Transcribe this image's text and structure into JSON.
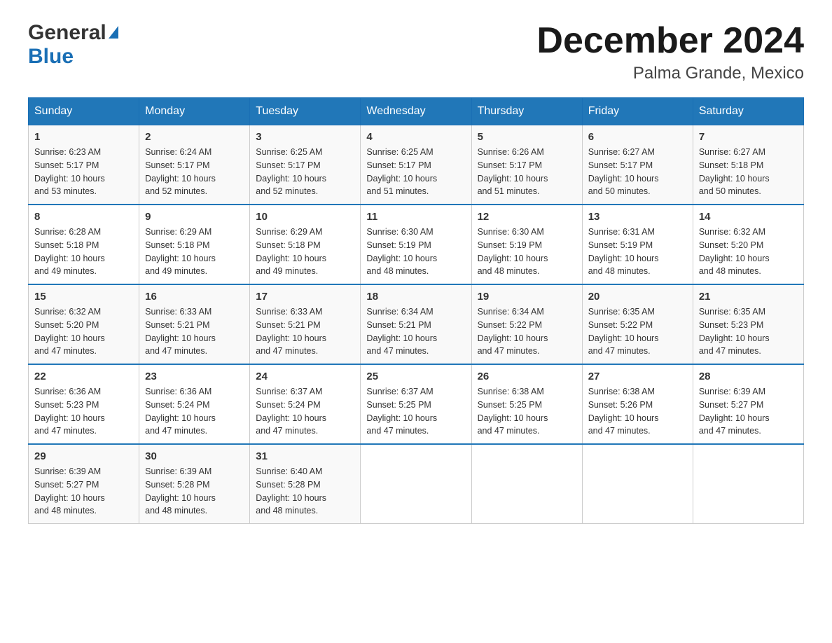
{
  "header": {
    "logo_general": "General",
    "logo_blue": "Blue",
    "month_title": "December 2024",
    "location": "Palma Grande, Mexico"
  },
  "days_of_week": [
    "Sunday",
    "Monday",
    "Tuesday",
    "Wednesday",
    "Thursday",
    "Friday",
    "Saturday"
  ],
  "weeks": [
    [
      {
        "day": "1",
        "sunrise": "6:23 AM",
        "sunset": "5:17 PM",
        "daylight": "10 hours and 53 minutes."
      },
      {
        "day": "2",
        "sunrise": "6:24 AM",
        "sunset": "5:17 PM",
        "daylight": "10 hours and 52 minutes."
      },
      {
        "day": "3",
        "sunrise": "6:25 AM",
        "sunset": "5:17 PM",
        "daylight": "10 hours and 52 minutes."
      },
      {
        "day": "4",
        "sunrise": "6:25 AM",
        "sunset": "5:17 PM",
        "daylight": "10 hours and 51 minutes."
      },
      {
        "day": "5",
        "sunrise": "6:26 AM",
        "sunset": "5:17 PM",
        "daylight": "10 hours and 51 minutes."
      },
      {
        "day": "6",
        "sunrise": "6:27 AM",
        "sunset": "5:17 PM",
        "daylight": "10 hours and 50 minutes."
      },
      {
        "day": "7",
        "sunrise": "6:27 AM",
        "sunset": "5:18 PM",
        "daylight": "10 hours and 50 minutes."
      }
    ],
    [
      {
        "day": "8",
        "sunrise": "6:28 AM",
        "sunset": "5:18 PM",
        "daylight": "10 hours and 49 minutes."
      },
      {
        "day": "9",
        "sunrise": "6:29 AM",
        "sunset": "5:18 PM",
        "daylight": "10 hours and 49 minutes."
      },
      {
        "day": "10",
        "sunrise": "6:29 AM",
        "sunset": "5:18 PM",
        "daylight": "10 hours and 49 minutes."
      },
      {
        "day": "11",
        "sunrise": "6:30 AM",
        "sunset": "5:19 PM",
        "daylight": "10 hours and 48 minutes."
      },
      {
        "day": "12",
        "sunrise": "6:30 AM",
        "sunset": "5:19 PM",
        "daylight": "10 hours and 48 minutes."
      },
      {
        "day": "13",
        "sunrise": "6:31 AM",
        "sunset": "5:19 PM",
        "daylight": "10 hours and 48 minutes."
      },
      {
        "day": "14",
        "sunrise": "6:32 AM",
        "sunset": "5:20 PM",
        "daylight": "10 hours and 48 minutes."
      }
    ],
    [
      {
        "day": "15",
        "sunrise": "6:32 AM",
        "sunset": "5:20 PM",
        "daylight": "10 hours and 47 minutes."
      },
      {
        "day": "16",
        "sunrise": "6:33 AM",
        "sunset": "5:21 PM",
        "daylight": "10 hours and 47 minutes."
      },
      {
        "day": "17",
        "sunrise": "6:33 AM",
        "sunset": "5:21 PM",
        "daylight": "10 hours and 47 minutes."
      },
      {
        "day": "18",
        "sunrise": "6:34 AM",
        "sunset": "5:21 PM",
        "daylight": "10 hours and 47 minutes."
      },
      {
        "day": "19",
        "sunrise": "6:34 AM",
        "sunset": "5:22 PM",
        "daylight": "10 hours and 47 minutes."
      },
      {
        "day": "20",
        "sunrise": "6:35 AM",
        "sunset": "5:22 PM",
        "daylight": "10 hours and 47 minutes."
      },
      {
        "day": "21",
        "sunrise": "6:35 AM",
        "sunset": "5:23 PM",
        "daylight": "10 hours and 47 minutes."
      }
    ],
    [
      {
        "day": "22",
        "sunrise": "6:36 AM",
        "sunset": "5:23 PM",
        "daylight": "10 hours and 47 minutes."
      },
      {
        "day": "23",
        "sunrise": "6:36 AM",
        "sunset": "5:24 PM",
        "daylight": "10 hours and 47 minutes."
      },
      {
        "day": "24",
        "sunrise": "6:37 AM",
        "sunset": "5:24 PM",
        "daylight": "10 hours and 47 minutes."
      },
      {
        "day": "25",
        "sunrise": "6:37 AM",
        "sunset": "5:25 PM",
        "daylight": "10 hours and 47 minutes."
      },
      {
        "day": "26",
        "sunrise": "6:38 AM",
        "sunset": "5:25 PM",
        "daylight": "10 hours and 47 minutes."
      },
      {
        "day": "27",
        "sunrise": "6:38 AM",
        "sunset": "5:26 PM",
        "daylight": "10 hours and 47 minutes."
      },
      {
        "day": "28",
        "sunrise": "6:39 AM",
        "sunset": "5:27 PM",
        "daylight": "10 hours and 47 minutes."
      }
    ],
    [
      {
        "day": "29",
        "sunrise": "6:39 AM",
        "sunset": "5:27 PM",
        "daylight": "10 hours and 48 minutes."
      },
      {
        "day": "30",
        "sunrise": "6:39 AM",
        "sunset": "5:28 PM",
        "daylight": "10 hours and 48 minutes."
      },
      {
        "day": "31",
        "sunrise": "6:40 AM",
        "sunset": "5:28 PM",
        "daylight": "10 hours and 48 minutes."
      },
      null,
      null,
      null,
      null
    ]
  ]
}
